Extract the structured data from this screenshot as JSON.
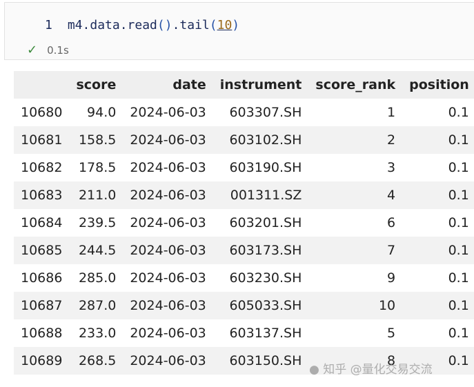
{
  "cell": {
    "line_number": "1",
    "code": {
      "obj": "m4.data.read",
      "open": "(",
      "close": ")",
      "tail": ".tail",
      "arg": "10"
    },
    "status_icon": "check-icon",
    "status_text": "0.1s"
  },
  "table": {
    "columns": [
      "",
      "score",
      "date",
      "instrument",
      "score_rank",
      "position"
    ],
    "rows": [
      [
        "10680",
        "94.0",
        "2024-06-03",
        "603307.SH",
        "1",
        "0.1"
      ],
      [
        "10681",
        "158.5",
        "2024-06-03",
        "603102.SH",
        "2",
        "0.1"
      ],
      [
        "10682",
        "178.5",
        "2024-06-03",
        "603190.SH",
        "3",
        "0.1"
      ],
      [
        "10683",
        "211.0",
        "2024-06-03",
        "001311.SZ",
        "4",
        "0.1"
      ],
      [
        "10684",
        "239.5",
        "2024-06-03",
        "603201.SH",
        "6",
        "0.1"
      ],
      [
        "10685",
        "244.5",
        "2024-06-03",
        "603173.SH",
        "7",
        "0.1"
      ],
      [
        "10686",
        "285.0",
        "2024-06-03",
        "603230.SH",
        "9",
        "0.1"
      ],
      [
        "10687",
        "287.0",
        "2024-06-03",
        "605033.SH",
        "10",
        "0.1"
      ],
      [
        "10688",
        "233.0",
        "2024-06-03",
        "603137.SH",
        "5",
        "0.1"
      ],
      [
        "10689",
        "268.5",
        "2024-06-03",
        "603150.SH",
        "8",
        "0.1"
      ]
    ]
  },
  "watermark": "知乎 @量化交易交流"
}
